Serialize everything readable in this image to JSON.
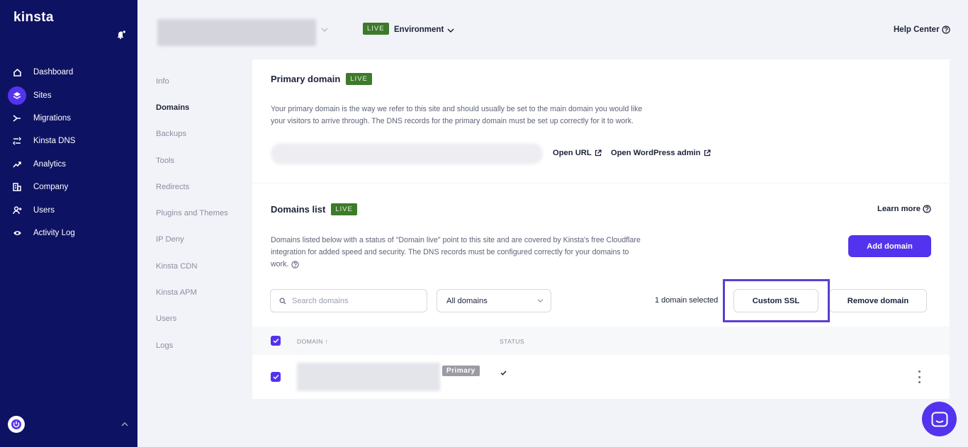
{
  "brand": {
    "logo_text": "kinsta"
  },
  "sidebar": {
    "items": [
      {
        "label": "Dashboard",
        "icon": "home-icon"
      },
      {
        "label": "Sites",
        "icon": "layers-icon",
        "active": true
      },
      {
        "label": "Migrations",
        "icon": "migration-icon"
      },
      {
        "label": "Kinsta DNS",
        "icon": "dns-icon"
      },
      {
        "label": "Analytics",
        "icon": "analytics-icon"
      },
      {
        "label": "Company",
        "icon": "company-icon"
      },
      {
        "label": "Users",
        "icon": "add-user-icon"
      },
      {
        "label": "Activity Log",
        "icon": "eye-icon"
      }
    ]
  },
  "topbar": {
    "environment_badge": "LIVE",
    "environment_label": "Environment",
    "help_label": "Help Center"
  },
  "subnav": {
    "items": [
      {
        "label": "Info"
      },
      {
        "label": "Domains",
        "active": true
      },
      {
        "label": "Backups"
      },
      {
        "label": "Tools"
      },
      {
        "label": "Redirects"
      },
      {
        "label": "Plugins and Themes"
      },
      {
        "label": "IP Deny"
      },
      {
        "label": "Kinsta CDN"
      },
      {
        "label": "Kinsta APM"
      },
      {
        "label": "Users"
      },
      {
        "label": "Logs"
      }
    ]
  },
  "primary_domain": {
    "title": "Primary domain",
    "badge": "LIVE",
    "desc_line1": "Your primary domain is the way we refer to this site and should usually be set to the main domain you would like",
    "desc_line2": "your visitors to arrive through. The DNS records for the primary domain must be set up correctly for it to work.",
    "open_url": "Open URL",
    "open_wp_admin": "Open WordPress admin"
  },
  "domains_list": {
    "title": "Domains list",
    "badge": "LIVE",
    "learn_more": "Learn more",
    "desc_line1": "Domains listed below with a status of \"Domain live\" point to this site and are covered by Kinsta's free Cloudflare",
    "desc_line2": "integration for added speed and security. The DNS records must be configured correctly for your domains to",
    "desc_line3": "work.",
    "add_domain": "Add domain",
    "search_placeholder": "Search domains",
    "filter_value": "All domains",
    "selected_count": "1 domain selected",
    "custom_ssl": "Custom SSL",
    "remove_domain": "Remove domain",
    "columns": {
      "domain": "DOMAIN ↑",
      "status": "STATUS"
    },
    "rows": [
      {
        "badge": "Primary"
      }
    ]
  },
  "colors": {
    "sidebar_bg": "#0e1263",
    "accent": "#5333ed",
    "live_green": "#3d7a2a",
    "highlight": "#5b3fd0"
  }
}
